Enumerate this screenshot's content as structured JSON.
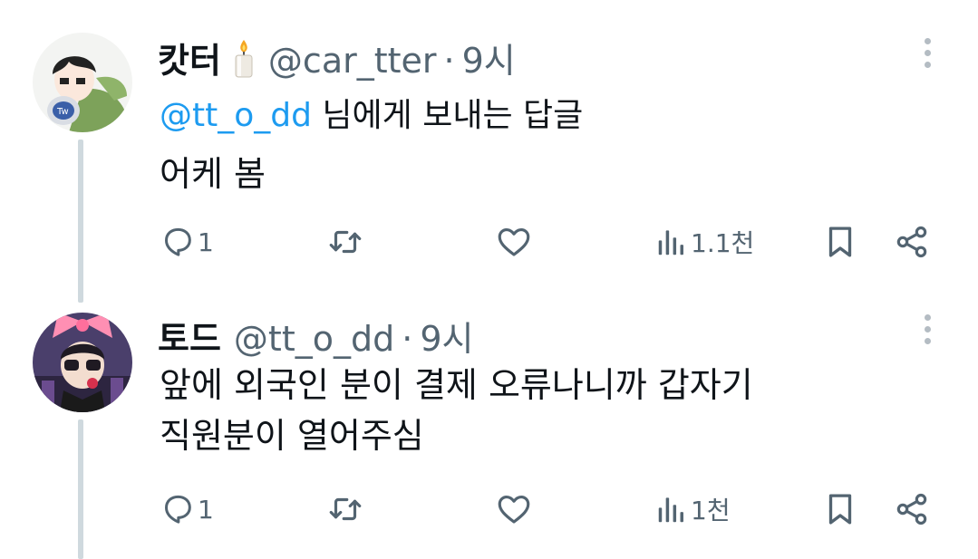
{
  "tweets": [
    {
      "name": "캇터",
      "name_emoji": "candle",
      "handle": "@car_tter",
      "separator": "·",
      "time": "9시",
      "reply_prefix_mention": "@tt_o_dd",
      "reply_suffix": " 님에게 보내는 답글",
      "text_lines": [
        "어케 봄"
      ],
      "reply_count": "1",
      "views": "1.1천"
    },
    {
      "name": "토드",
      "handle": "@tt_o_dd",
      "separator": "·",
      "time": "9시",
      "text_lines": [
        "앞에 외국인 분이 결제 오류나니까 갑자기",
        "직원분이 열어주심"
      ],
      "reply_count": "1",
      "views": "1천"
    }
  ],
  "icons": {
    "reply": "reply-icon",
    "retweet": "retweet-icon",
    "like": "heart-icon",
    "views": "views-icon",
    "bookmark": "bookmark-icon",
    "share": "share-icon",
    "more": "more-vertical-icon"
  },
  "colors": {
    "mention": "#1d9bf0",
    "secondary": "#536471",
    "thread_line": "#cfd9de"
  }
}
